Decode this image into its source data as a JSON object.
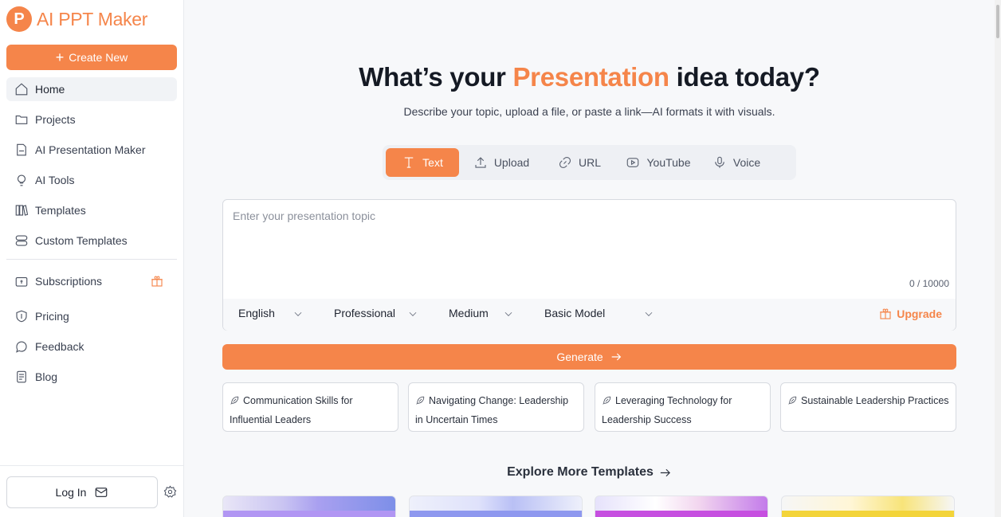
{
  "app": {
    "logo_letter": "P",
    "name": "AI PPT Maker",
    "accent_color": "#f5854a"
  },
  "sidebar": {
    "create_label": "Create New",
    "items": [
      {
        "label": "Home",
        "icon": "home-icon",
        "active": true
      },
      {
        "label": "Projects",
        "icon": "folder-icon"
      },
      {
        "label": "AI Presentation Maker",
        "icon": "ppt-icon"
      },
      {
        "label": "AI Tools",
        "icon": "bulb-icon"
      },
      {
        "label": "Templates",
        "icon": "books-icon"
      },
      {
        "label": "Custom Templates",
        "icon": "toggle-icon"
      },
      {
        "label": "Subscriptions",
        "icon": "wallet-icon"
      },
      {
        "label": "Pricing",
        "icon": "dollar-shield-icon"
      },
      {
        "label": "Feedback",
        "icon": "chat-icon"
      },
      {
        "label": "Blog",
        "icon": "document-icon"
      }
    ],
    "login_label": "Log In"
  },
  "main": {
    "headline_pre": "What’s your ",
    "headline_accent": "Presentation",
    "headline_post": " idea today?",
    "subline": "Describe your topic, upload a file, or paste a link—AI formats it with visuals.",
    "tabs": [
      {
        "label": "Text",
        "active": true
      },
      {
        "label": "Upload"
      },
      {
        "label": "URL"
      },
      {
        "label": "YouTube"
      },
      {
        "label": "Voice"
      }
    ],
    "topic_placeholder": "Enter your presentation topic",
    "counter": "0 / 10000",
    "options": {
      "language": "English",
      "tone": "Professional",
      "length": "Medium",
      "model": "Basic Model"
    },
    "upgrade_label": "Upgrade",
    "generate_label": "Generate",
    "suggestions": [
      "Communication Skills for Influential Leaders",
      "Navigating Change: Leadership in Uncertain Times",
      "Leveraging Technology for Leadership Success",
      "Sustainable Leadership Practices"
    ],
    "explore_label": "Explore More Templates"
  }
}
